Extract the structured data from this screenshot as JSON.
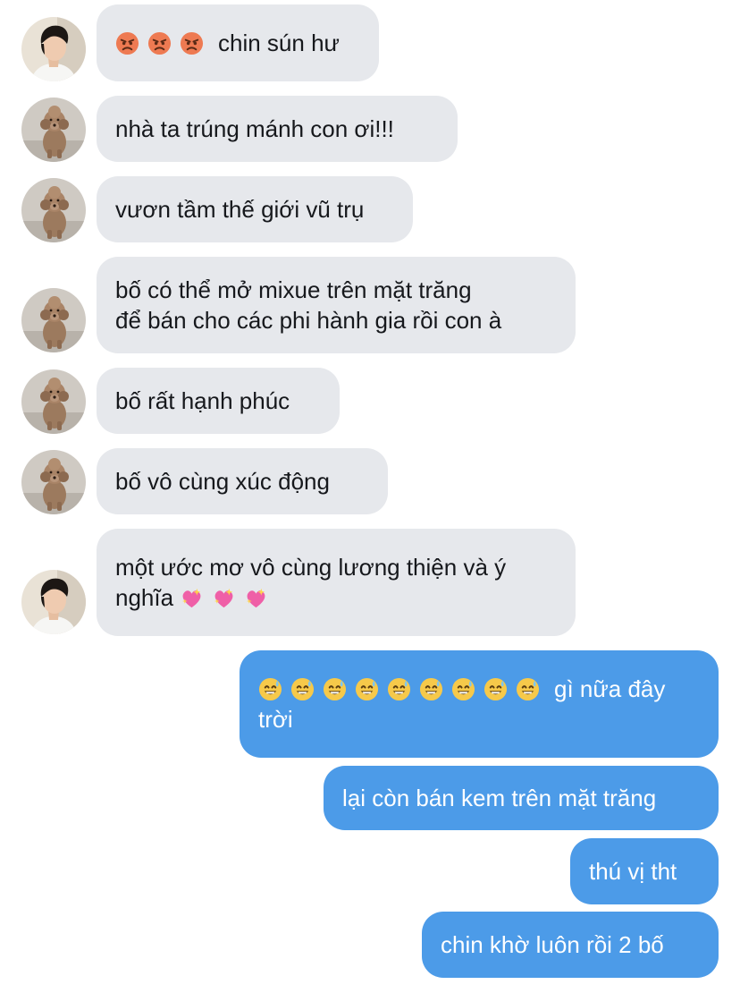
{
  "avatars": {
    "boy": "boy-avatar",
    "dog": "dog-avatar"
  },
  "icons": {
    "angry": "angry-face-icon",
    "heart": "sparkling-heart-icon",
    "sweat": "grinning-face-with-sweat-icon"
  },
  "colors": {
    "incoming_bubble": "#e6e8ec",
    "outgoing_bubble": "#4c9be8",
    "incoming_text": "#16181c",
    "outgoing_text": "#ffffff"
  },
  "messages": [
    {
      "side": "in",
      "avatar": "boy",
      "emojis": [
        "angry",
        "angry",
        "angry"
      ],
      "text": "chin sún hư"
    },
    {
      "side": "in",
      "avatar": "dog",
      "emojis": [],
      "text": "nhà ta trúng mánh con ơi!!!"
    },
    {
      "side": "in",
      "avatar": "dog",
      "emojis": [],
      "text": "vươn tầm thế giới vũ trụ"
    },
    {
      "side": "in",
      "avatar": "dog",
      "emojis": [],
      "text": "bố có thể mở mixue trên mặt trăng\nđể bán cho các phi hành gia rồi con à"
    },
    {
      "side": "in",
      "avatar": "dog",
      "emojis": [],
      "text": "bố rất hạnh phúc"
    },
    {
      "side": "in",
      "avatar": "dog",
      "emojis": [],
      "text": "bố vô cùng xúc động"
    },
    {
      "side": "in",
      "avatar": "boy",
      "emojis": [],
      "text": "một ước mơ vô cùng lương thiện và ý\nnghĩa",
      "trailing_emojis": [
        "heart",
        "heart",
        "heart"
      ]
    },
    {
      "side": "out",
      "emojis": [
        "sweat",
        "sweat",
        "sweat",
        "sweat",
        "sweat",
        "sweat",
        "sweat",
        "sweat",
        "sweat"
      ],
      "text": "gì nữa đây\ntrời"
    },
    {
      "side": "out",
      "emojis": [],
      "text": "lại còn bán kem trên mặt trăng"
    },
    {
      "side": "out",
      "emojis": [],
      "text": "thú vị tht"
    },
    {
      "side": "out",
      "emojis": [],
      "text": "chin khờ luôn rồi 2 bố"
    }
  ]
}
